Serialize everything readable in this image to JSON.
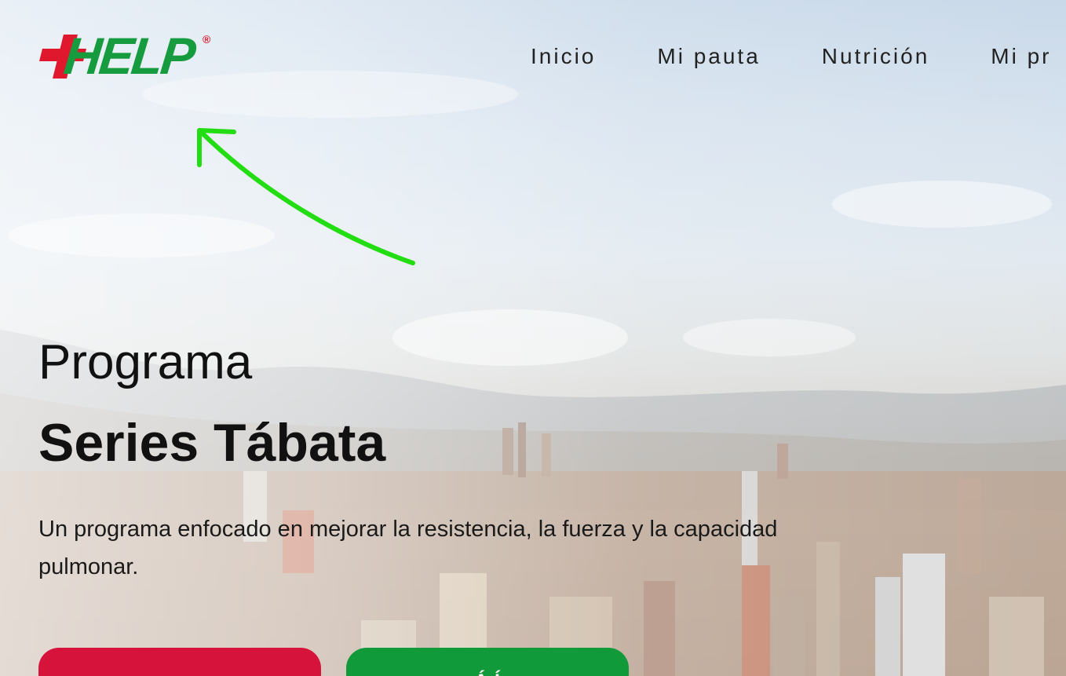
{
  "header": {
    "logo": {
      "text": "HELP",
      "mark": "®",
      "colors": {
        "cross": "#e0182d",
        "letters": "#169c3f"
      }
    },
    "nav": [
      {
        "label": "Inicio"
      },
      {
        "label": "Mi pauta"
      },
      {
        "label": "Nutrición"
      },
      {
        "label": "Mi pr"
      }
    ]
  },
  "annotation": {
    "icon": "arrow-icon",
    "color": "#22dd11"
  },
  "hero": {
    "title_light": "Programa",
    "title_bold": "Series Tábata",
    "description": "Un programa enfocado en mejorar la resistencia, la fuerza y la capacidad pulmonar.",
    "buttons": [
      {
        "label": "",
        "color": "#d6133a"
      },
      {
        "label": "Á Í",
        "color": "#119a3a"
      }
    ]
  }
}
